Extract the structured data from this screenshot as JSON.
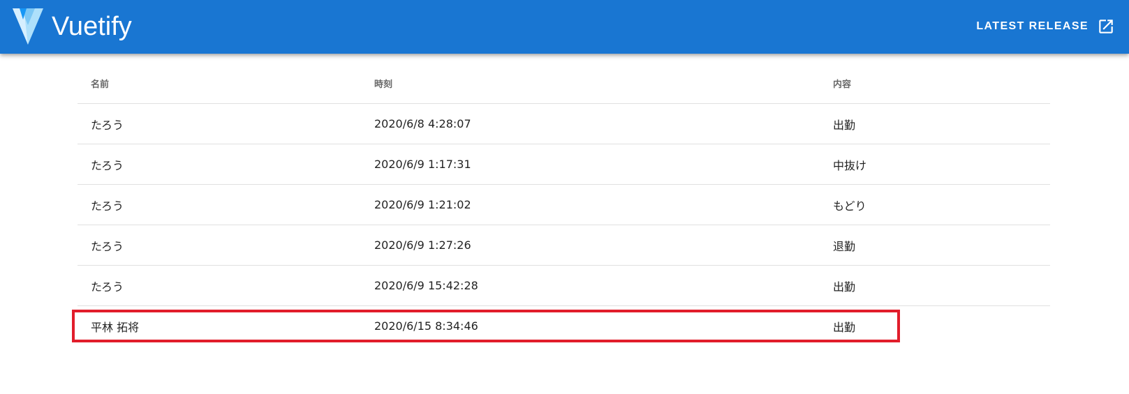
{
  "app_bar": {
    "brand": "Vuetify",
    "release_button_label": "LATEST RELEASE",
    "release_icon": "open-in-new-icon",
    "color": "#1976d2"
  },
  "table": {
    "headers": [
      "名前",
      "時刻",
      "内容"
    ],
    "rows": [
      {
        "name": "たろう",
        "time": "2020/6/8 4:28:07",
        "content": "出勤"
      },
      {
        "name": "たろう",
        "time": "2020/6/9 1:17:31",
        "content": "中抜け"
      },
      {
        "name": "たろう",
        "time": "2020/6/9 1:21:02",
        "content": "もどり"
      },
      {
        "name": "たろう",
        "time": "2020/6/9 1:27:26",
        "content": "退勤"
      },
      {
        "name": "たろう",
        "time": "2020/6/9 15:42:28",
        "content": "出勤"
      },
      {
        "name": "平林 拓将",
        "time": "2020/6/15 8:34:46",
        "content": "出勤"
      }
    ]
  },
  "highlight": {
    "row_index": 5,
    "color": "#e11d2b"
  }
}
